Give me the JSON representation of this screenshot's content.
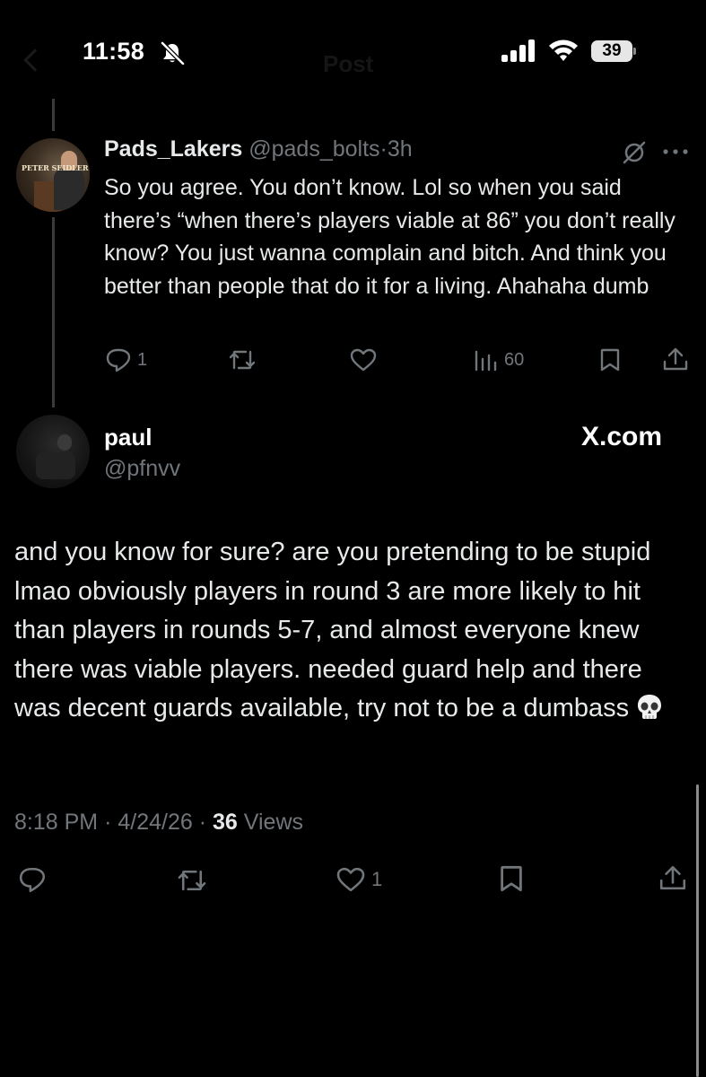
{
  "status_bar": {
    "time": "11:58",
    "battery": "39"
  },
  "ghost_header": {
    "title": "Post"
  },
  "reply_tweet": {
    "name": "Pads_Lakers",
    "handle": "@pads_bolts",
    "separator": "·",
    "time": "3h",
    "avatar_sign": "PETER SEIDLER",
    "text": "So you agree. You don’t know. Lol so when you said there’s “when there’s players viable at 86” you don’t really know? You just wanna complain and bitch. And think you better than people that do it for a living. Ahahaha dumb",
    "actions": {
      "replies": "1",
      "views": "60"
    }
  },
  "main_tweet": {
    "name": "paul",
    "handle": "@pfnvv",
    "text": "and you know for sure? are you pretending to be stupid lmao obviously players in round 3 are more likely to hit than players in rounds 5-7, and almost everyone knew there was viable players. needed guard help and there was decent guards available, try not to be a dumbass",
    "time": "8:18 PM",
    "date": "4/24/26",
    "separator": "·",
    "views_count": "36",
    "views_label": "Views",
    "actions": {
      "likes": "1"
    }
  },
  "watermark": "X.com",
  "icons": [
    "bell-slash-icon",
    "signal-icon",
    "wifi-icon",
    "battery-icon",
    "grok-slash-icon",
    "more-icon",
    "reply-icon",
    "retweet-icon",
    "like-icon",
    "views-icon",
    "bookmark-icon",
    "share-icon",
    "skull-icon"
  ],
  "colors": {
    "background": "#000000",
    "text": "#e7e9ea",
    "secondary": "#71767b",
    "thread_line": "#3a3a3a"
  }
}
